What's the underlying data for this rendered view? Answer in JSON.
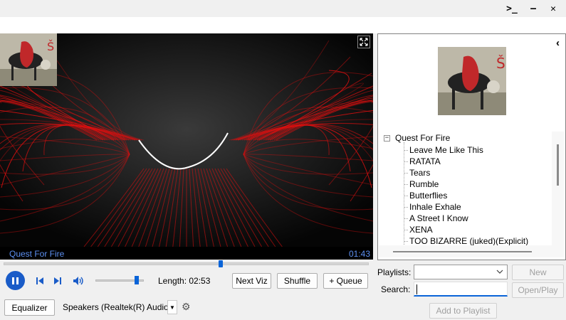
{
  "titlebar": {
    "terminal_icon": ">_",
    "minimize_icon": "—",
    "close_icon": "✕"
  },
  "visualizer": {
    "now_playing": "Quest For Fire",
    "elapsed": "01:43",
    "accent_color": "#e01010"
  },
  "controls": {
    "seek_progress": 0.595,
    "volume_level": 0.85,
    "length_label": "Length: 02:53",
    "next_viz_label": "Next Viz",
    "shuffle_label": "Shuffle",
    "queue_label": "+ Queue",
    "equalizer_label": "Equalizer",
    "output_device": "Speakers (Realtek(R) Audio)"
  },
  "library": {
    "album": "Quest For Fire",
    "expander": "−",
    "tracks": [
      "Leave Me Like This",
      "RATATA",
      "Tears",
      "Rumble",
      "Butterflies",
      "Inhale Exhale",
      "A Street I Know",
      "XENA",
      "TOO BIZARRE (juked)(Explicit)"
    ]
  },
  "playlist": {
    "playlists_label": "Playlists:",
    "playlists_value": "",
    "new_label": "New",
    "search_label": "Search:",
    "search_value": "",
    "open_play_label": "Open/Play",
    "add_to_playlist_label": "Add to Playlist"
  }
}
